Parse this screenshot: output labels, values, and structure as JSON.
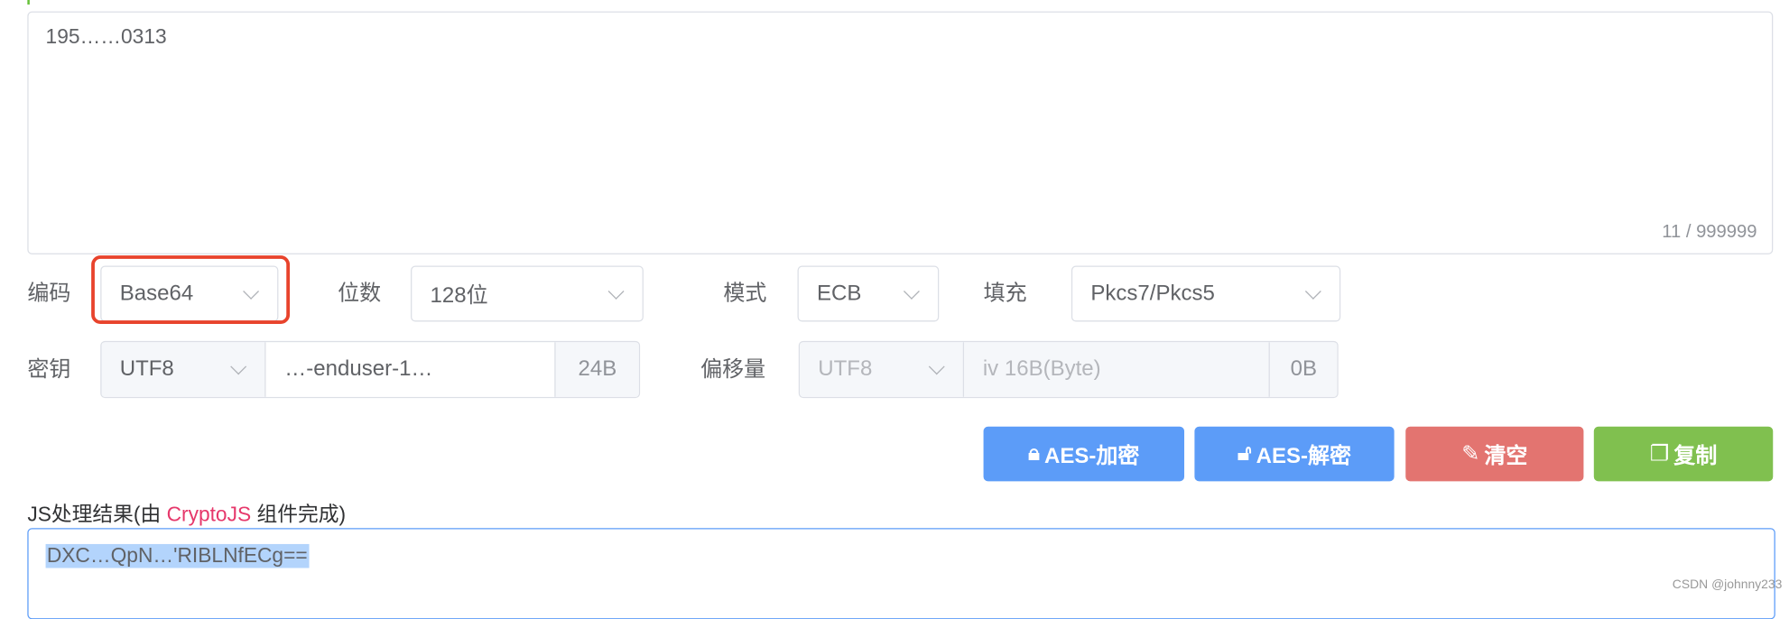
{
  "input": {
    "value": "195……0313",
    "counter": "11 / 999999"
  },
  "row1": {
    "encoding_label": "编码",
    "encoding_value": "Base64",
    "bits_label": "位数",
    "bits_value": "128位",
    "mode_label": "模式",
    "mode_value": "ECB",
    "padding_label": "填充",
    "padding_value": "Pkcs7/Pkcs5"
  },
  "row2": {
    "key_label": "密钥",
    "key_charset": "UTF8",
    "key_value": "…-enduser-1…",
    "key_size": "24B",
    "iv_label": "偏移量",
    "iv_charset": "UTF8",
    "iv_placeholder": "iv 16B(Byte)",
    "iv_size": "0B"
  },
  "buttons": {
    "encrypt": "AES-加密",
    "decrypt": "AES-解密",
    "clear": "清空",
    "copy": "复制"
  },
  "colors": {
    "primary": "#5c9cf8",
    "danger": "#e37470",
    "success": "#80c04f",
    "highlight": "#e8432c",
    "accent_text": "#e6386b"
  },
  "result": {
    "label_prefix": "JS处理结果(由 ",
    "label_lib": "CryptoJS",
    "label_suffix": " 组件完成)",
    "value": "DXC…QpN…'RIBLNfECg=="
  },
  "watermark": "CSDN @johnny233"
}
